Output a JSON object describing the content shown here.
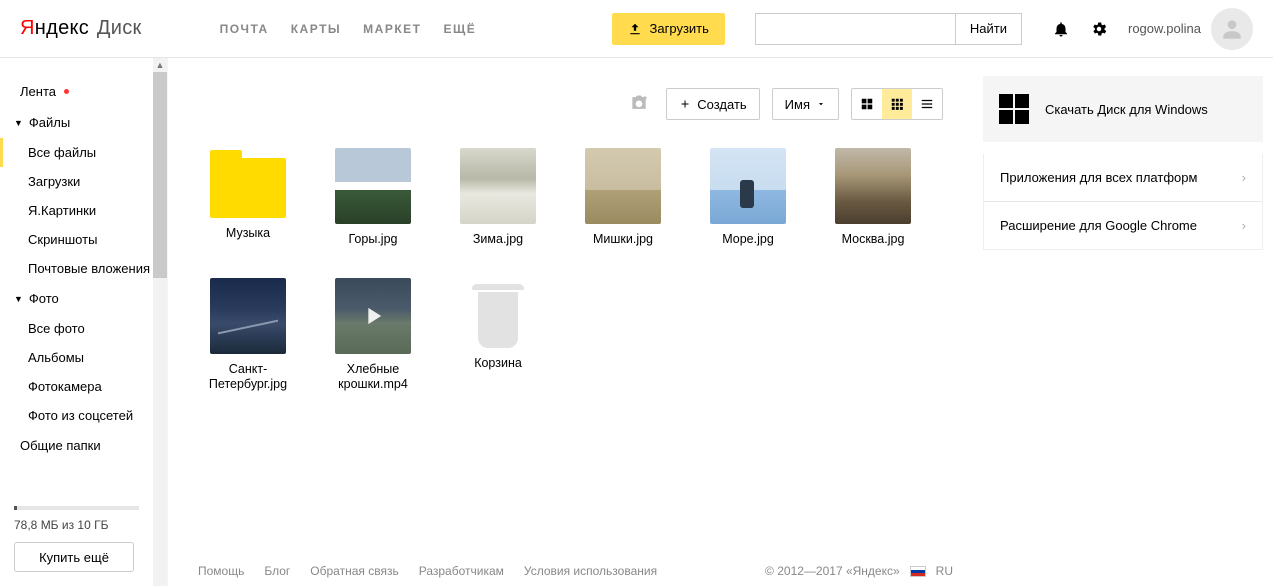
{
  "header": {
    "logo": {
      "y": "Я",
      "rest": "ндекс",
      "service": "Диск"
    },
    "nav": [
      "ПОЧТА",
      "КАРТЫ",
      "МАРКЕТ",
      "ЕЩЁ"
    ],
    "upload_label": "Загрузить",
    "search_btn": "Найти",
    "username": "rogow.polina"
  },
  "sidebar": {
    "feed": "Лента",
    "files_group": "Файлы",
    "files_items": [
      "Все файлы",
      "Загрузки",
      "Я.Картинки",
      "Скриншоты",
      "Почтовые вложения"
    ],
    "photo_group": "Фото",
    "photo_items": [
      "Все фото",
      "Альбомы",
      "Фотокамера",
      "Фото из соцсетей"
    ],
    "shared": "Общие папки",
    "storage_text": "78,8 МБ из 10 ГБ",
    "buy_label": "Купить ещё"
  },
  "toolbar": {
    "create": "Создать",
    "sort": "Имя"
  },
  "files": [
    {
      "kind": "folder",
      "label": "Музыка"
    },
    {
      "kind": "image",
      "label": "Горы.jpg",
      "thumb": "th-mountain"
    },
    {
      "kind": "image",
      "label": "Зима.jpg",
      "thumb": "th-winter"
    },
    {
      "kind": "image",
      "label": "Мишки.jpg",
      "thumb": "th-bears"
    },
    {
      "kind": "image",
      "label": "Море.jpg",
      "thumb": "th-sea"
    },
    {
      "kind": "image",
      "label": "Москва.jpg",
      "thumb": "th-moscow"
    },
    {
      "kind": "image",
      "label": "Санкт-Петербург.jpg",
      "thumb": "th-spb"
    },
    {
      "kind": "video",
      "label": "Хлебные крошки.mp4",
      "thumb": "th-video"
    },
    {
      "kind": "trash",
      "label": "Корзина"
    }
  ],
  "rightpanel": {
    "download_win": "Скачать Диск для Windows",
    "links": [
      "Приложения для всех платформ",
      "Расширение для Google Chrome"
    ]
  },
  "footer": {
    "links": [
      "Помощь",
      "Блог",
      "Обратная связь",
      "Разработчикам",
      "Условия использования"
    ],
    "copyright": "© 2012—2017 «Яндекс»",
    "lang": "RU"
  }
}
